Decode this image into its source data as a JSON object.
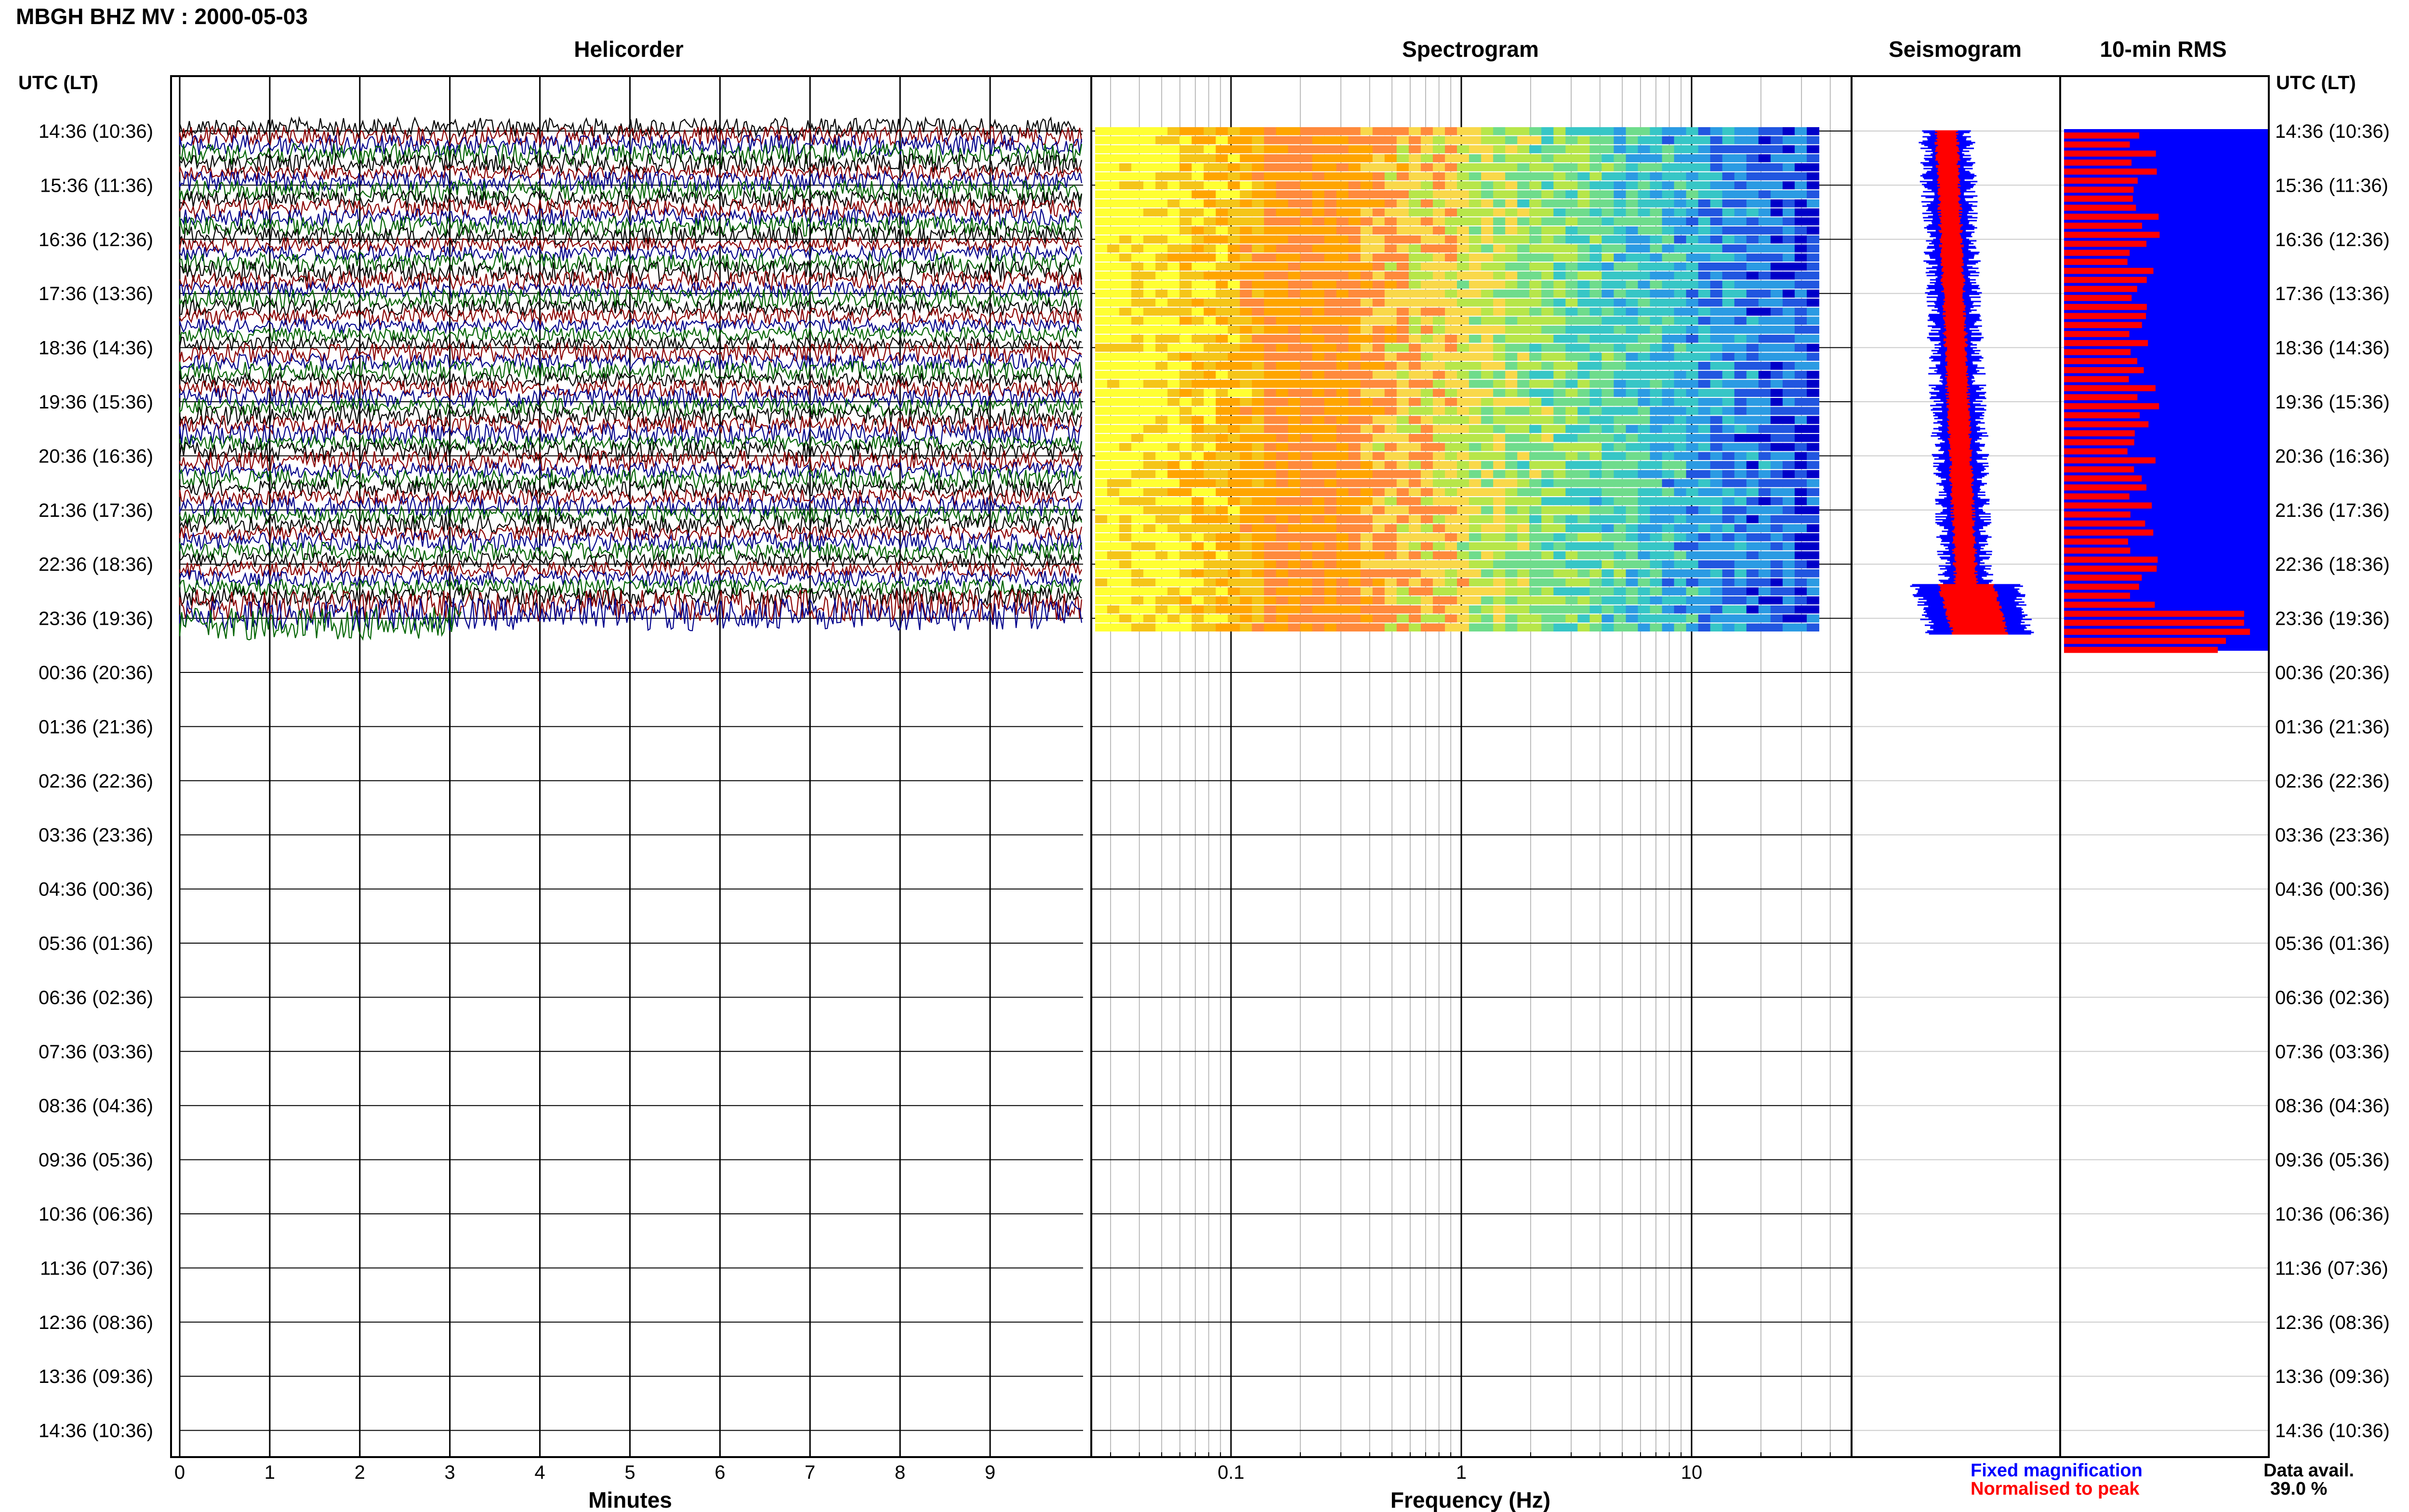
{
  "page_title": "MBGH BHZ MV : 2000-05-03",
  "time_axis_label": "UTC (LT)",
  "time_labels": [
    "14:36 (10:36)",
    "15:36 (11:36)",
    "16:36 (12:36)",
    "17:36 (13:36)",
    "18:36 (14:36)",
    "19:36 (15:36)",
    "20:36 (16:36)",
    "21:36 (17:36)",
    "22:36 (18:36)",
    "23:36 (19:36)",
    "00:36 (20:36)",
    "01:36 (21:36)",
    "02:36 (22:36)",
    "03:36 (23:36)",
    "04:36 (00:36)",
    "05:36 (01:36)",
    "06:36 (02:36)",
    "07:36 (03:36)",
    "08:36 (04:36)",
    "09:36 (05:36)",
    "10:36 (06:36)",
    "11:36 (07:36)",
    "12:36 (08:36)",
    "13:36 (09:36)",
    "14:36 (10:36)"
  ],
  "footer": {
    "legend_fixed": "Fixed magnification",
    "legend_normalised": "Normalised to peak",
    "data_avail_label": "Data avail.",
    "data_avail_value": "39.0 %"
  },
  "colors": {
    "black_trace": "#000000",
    "red_trace": "#8b0000",
    "blue_trace": "#00008b",
    "green_trace": "#006400",
    "fixed_magnification": "#0000ff",
    "normalised_to_peak": "#ff0000"
  },
  "chart_data": [
    {
      "type": "line",
      "title": "Helicorder",
      "xlabel": "Minutes",
      "ylabel": "",
      "xlim": [
        0,
        10
      ],
      "xticks": [
        "0",
        "1",
        "2",
        "3",
        "4",
        "5",
        "6",
        "7",
        "8",
        "9"
      ],
      "trace_colors_cycle": [
        "black",
        "red",
        "blue",
        "green"
      ],
      "traces_per_hour": 6,
      "data_hours": 9.4
    },
    {
      "type": "heatmap",
      "title": "Spectrogram",
      "xlabel": "Frequency (Hz)",
      "ylabel": "",
      "xscale": "log",
      "xlim": [
        0.03,
        50
      ],
      "xticks": [
        "0.1",
        "1",
        "10"
      ],
      "colormap": "jet",
      "data_hours": 9.4
    },
    {
      "type": "line",
      "title": "Seismogram",
      "xlabel": "",
      "ylabel": "",
      "series": [
        {
          "name": "Fixed magnification"
        },
        {
          "name": "Normalised to peak"
        }
      ]
    },
    {
      "type": "bar",
      "title": "10-min RMS",
      "xlabel": "",
      "ylabel": "",
      "data_hours": 9.6
    }
  ]
}
